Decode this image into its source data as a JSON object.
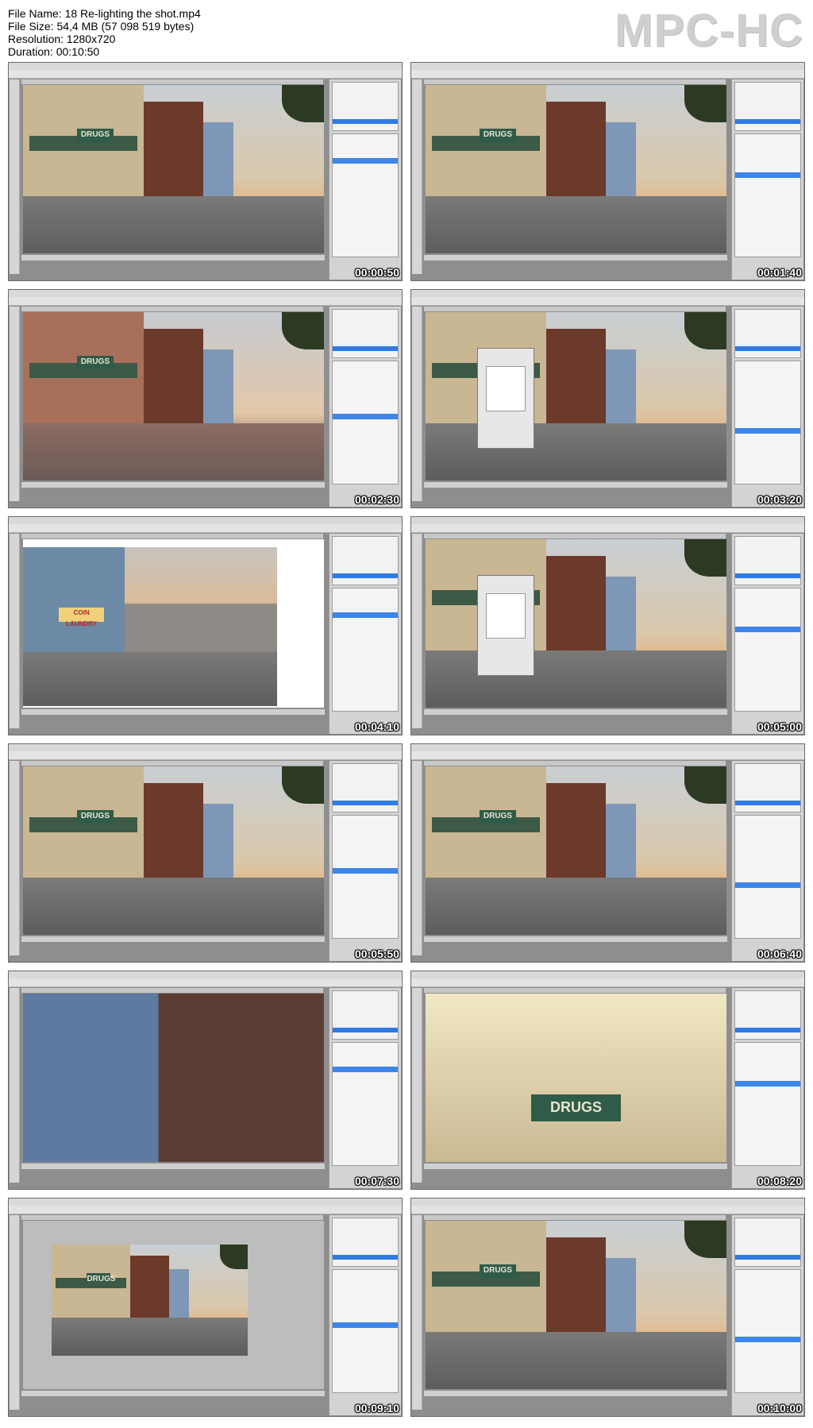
{
  "file_info": {
    "file_name": "File Name: 18 Re-lighting the shot.mp4",
    "file_size": "File Size: 54,4 MB (57 098 519 bytes)",
    "resolution": "Resolution: 1280x720",
    "duration": "Duration: 00:10:50"
  },
  "brand": "MPC-HC",
  "thumbnails": [
    {
      "timestamp": "00:00:50",
      "scene": "street"
    },
    {
      "timestamp": "00:01:40",
      "scene": "street"
    },
    {
      "timestamp": "00:02:30",
      "scene": "street-warm"
    },
    {
      "timestamp": "00:03:20",
      "scene": "street-curves"
    },
    {
      "timestamp": "00:04:10",
      "scene": "browser-photo",
      "sign_text": "COIN LAUNDRY"
    },
    {
      "timestamp": "00:05:00",
      "scene": "street-curves"
    },
    {
      "timestamp": "00:05:50",
      "scene": "street"
    },
    {
      "timestamp": "00:06:40",
      "scene": "street"
    },
    {
      "timestamp": "00:07:30",
      "scene": "closeup-building"
    },
    {
      "timestamp": "00:08:20",
      "scene": "closeup-sign"
    },
    {
      "timestamp": "00:09:10",
      "scene": "zoomed-out"
    },
    {
      "timestamp": "00:10:00",
      "scene": "street-dialog"
    }
  ],
  "sign_text": "DRUGS",
  "colors": {
    "layer_highlight": "#3d85e8",
    "timestamp_text": "#ffffff",
    "brand_text": "#cfcfcf"
  }
}
